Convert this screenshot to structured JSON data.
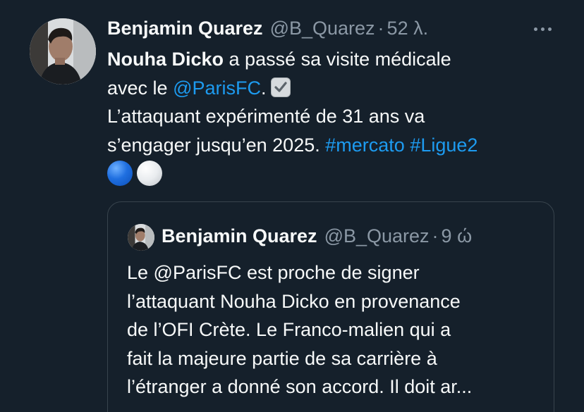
{
  "tweet": {
    "author": {
      "display_name": "Benjamin Quarez",
      "handle": "@B_Quarez",
      "separator": "·",
      "time": "52 λ."
    },
    "more_icon": "more-horizontal-icon",
    "text": {
      "mention_name": "Nouha Dicko",
      "line1_rest": " a passé sa visite médicale",
      "line2_prefix": "avec le ",
      "line2_mention": "@ParisFC",
      "line2_suffix": ".",
      "line3": "L’attaquant expérimenté de 31 ans va",
      "line4_prefix": "s’engager jusqu’en 2025. ",
      "hashtag1": "#mercato",
      "hashtag_space": " ",
      "hashtag2": "#Ligue2",
      "emoji_check": "check-box-with-check-emoji",
      "emoji_blue_circle": "blue-circle-emoji",
      "emoji_white_circle": "white-circle-emoji"
    }
  },
  "quoted_tweet": {
    "author": {
      "display_name": "Benjamin Quarez",
      "handle": "@B_Quarez",
      "separator": "·",
      "time": "9 ώ"
    },
    "lines": [
      "Le @ParisFC est proche de signer",
      "l’attaquant Nouha Dicko en provenance",
      "de l’OFI Crète. Le Franco-malien qui a",
      "fait la majeure partie de sa carrière à",
      "l’étranger a donné son accord. Il doit ar..."
    ]
  },
  "colors": {
    "background": "#15202b",
    "text": "#f7f9f9",
    "secondary": "#8b98a5",
    "link": "#1d9bf0",
    "border": "#38444d"
  }
}
